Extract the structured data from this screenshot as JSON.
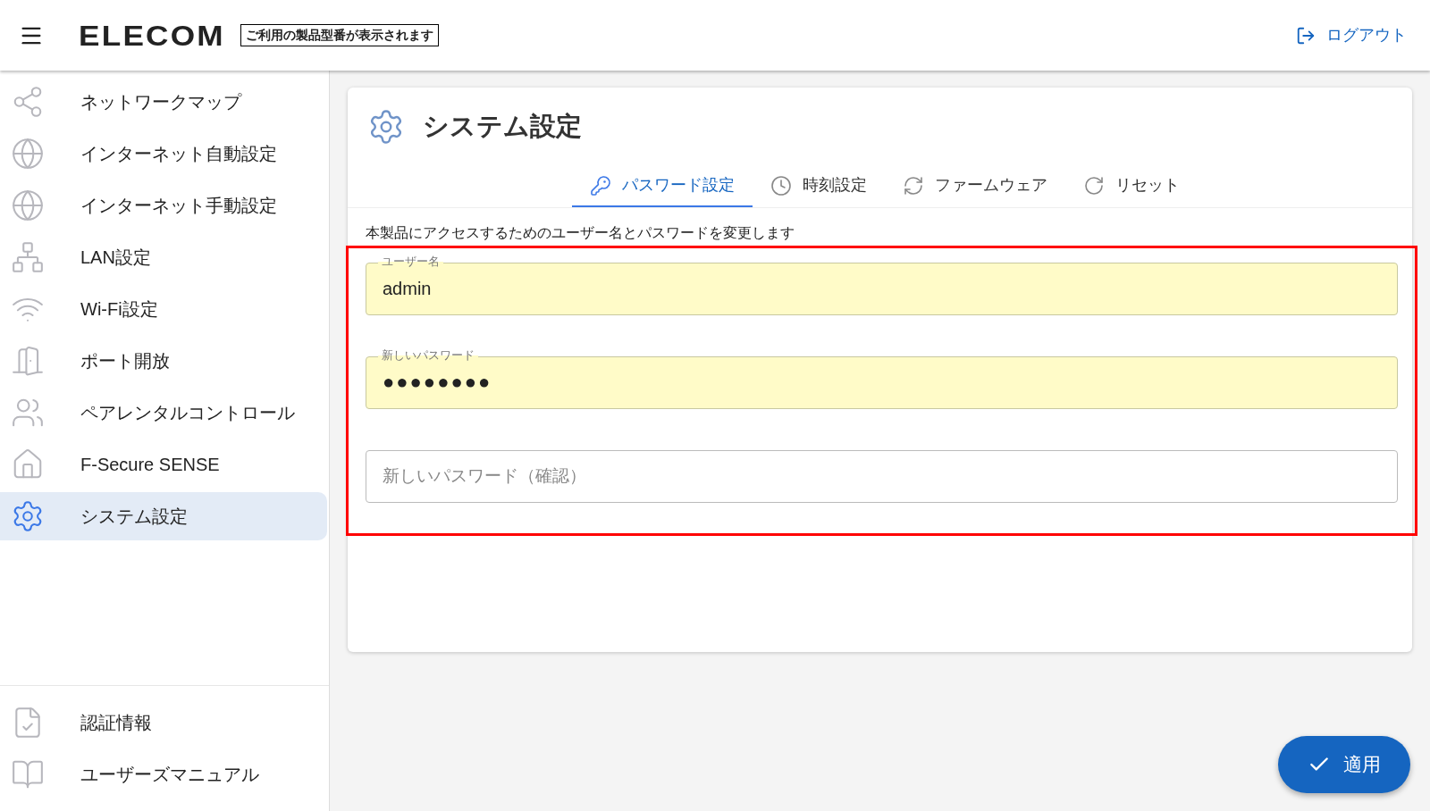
{
  "header": {
    "logo": "ELECOM",
    "model_label": "ご利用の製品型番が表示されます",
    "logout": "ログアウト"
  },
  "sidebar": {
    "items": [
      {
        "label": "ネットワークマップ",
        "selected": false
      },
      {
        "label": "インターネット自動設定",
        "selected": false
      },
      {
        "label": "インターネット手動設定",
        "selected": false
      },
      {
        "label": "LAN設定",
        "selected": false
      },
      {
        "label": "Wi-Fi設定",
        "selected": false
      },
      {
        "label": "ポート開放",
        "selected": false
      },
      {
        "label": "ペアレンタルコントロール",
        "selected": false
      },
      {
        "label": "F-Secure SENSE",
        "selected": false
      },
      {
        "label": "システム設定",
        "selected": true
      }
    ],
    "footer_items": [
      {
        "label": "認証情報"
      },
      {
        "label": "ユーザーズマニュアル"
      }
    ]
  },
  "page": {
    "title": "システム設定",
    "tabs": [
      {
        "label": "パスワード設定",
        "selected": true
      },
      {
        "label": "時刻設定",
        "selected": false
      },
      {
        "label": "ファームウェア",
        "selected": false
      },
      {
        "label": "リセット",
        "selected": false
      }
    ],
    "description": "本製品にアクセスするためのユーザー名とパスワードを変更します",
    "fields": [
      {
        "label": "ユーザー名",
        "value": "admin"
      },
      {
        "label": "新しいパスワード",
        "value": "●●●●●●●●"
      },
      {
        "placeholder": "新しいパスワード（確認）"
      }
    ]
  },
  "apply_button": "適用"
}
